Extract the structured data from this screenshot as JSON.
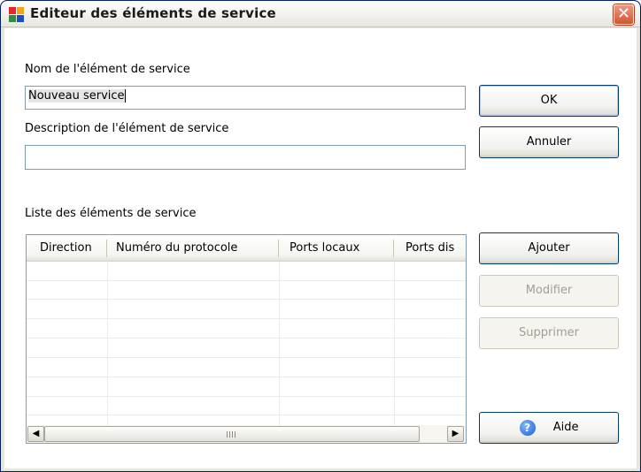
{
  "window": {
    "title": "Editeur des éléments de service",
    "close_glyph": "✕"
  },
  "form": {
    "name_label": "Nom de l'élément de service",
    "name_value": "Nouveau service",
    "description_label": "Description de l'élément de service",
    "description_value": "",
    "list_label": "Liste des éléments de service"
  },
  "buttons": {
    "ok": "OK",
    "cancel": "Annuler",
    "add": "Ajouter",
    "modify": "Modifier",
    "delete": "Supprimer",
    "help": "Aide",
    "help_icon_glyph": "?"
  },
  "list": {
    "columns": [
      "Direction",
      "Numéro du protocole",
      "Ports locaux",
      "Ports dis"
    ],
    "rows": []
  },
  "scrollbar": {
    "left_glyph": "◀",
    "right_glyph": "▶"
  },
  "colors": {
    "titlebar": "#f3f3ef",
    "close_button": "#d4552f",
    "border": "#7f9db9",
    "disabled_text": "#a19f95"
  }
}
